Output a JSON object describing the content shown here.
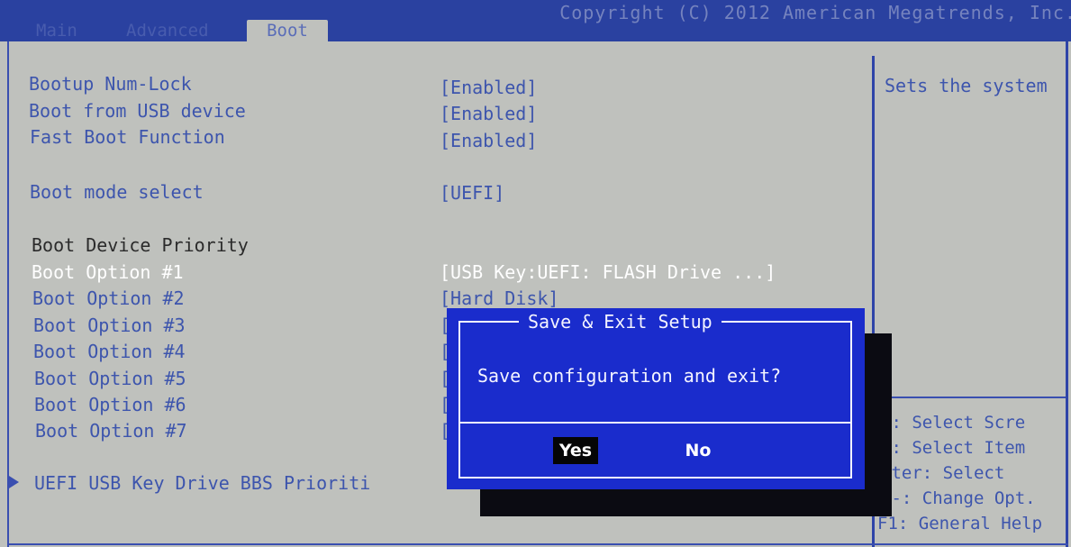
{
  "header": {
    "vendor_text": "Copyright (C) 2012 American Megatrends, Inc.",
    "tabs": [
      {
        "label": "Main"
      },
      {
        "label": "Advanced"
      },
      {
        "label": "Boot"
      }
    ],
    "active_tab": "Boot"
  },
  "settings": [
    {
      "label": "Bootup Num-Lock",
      "value": "[Enabled]"
    },
    {
      "label": "Boot from USB device",
      "value": "[Enabled]"
    },
    {
      "label": "Fast Boot Function",
      "value": "[Enabled]"
    },
    {
      "label": "Boot mode select",
      "value": "[UEFI]"
    }
  ],
  "boot_priority": {
    "title": "Boot Device Priority",
    "options": [
      {
        "label": "Boot Option #1",
        "value": "[USB Key:UEFI: FLASH Drive ...]"
      },
      {
        "label": "Boot Option #2",
        "value": "[Hard Disk]"
      },
      {
        "label": "Boot Option #3",
        "value": "["
      },
      {
        "label": "Boot Option #4",
        "value": "["
      },
      {
        "label": "Boot Option #5",
        "value": "["
      },
      {
        "label": "Boot Option #6",
        "value": "["
      },
      {
        "label": "Boot Option #7",
        "value": "["
      }
    ],
    "selected_index": 0
  },
  "submenu": {
    "label": "UEFI USB Key Drive BBS Prioriti"
  },
  "help": {
    "description": "Sets the system",
    "keys": [
      "←: Select Scre",
      "↓: Select Item",
      "nter: Select",
      "/-: Change Opt.",
      "F1: General Help"
    ]
  },
  "dialog": {
    "title": "Save & Exit Setup",
    "message": "Save configuration and exit?",
    "yes_label": "Yes",
    "no_label": "No",
    "selected": "Yes"
  },
  "colors": {
    "bios_blue": "#2a41a0",
    "panel_gray": "#bfc1bd",
    "dialog_blue": "#1a2ccc",
    "text_blue": "#3d55ad"
  }
}
